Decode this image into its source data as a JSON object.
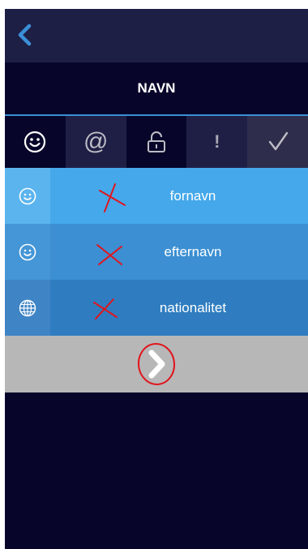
{
  "header": {
    "back_icon": "chevron-left-icon",
    "title": "NAVN"
  },
  "tabs": [
    {
      "icon": "smiley-icon",
      "active": true
    },
    {
      "icon": "at-sign-icon",
      "glyph": "@"
    },
    {
      "icon": "padlock-icon"
    },
    {
      "icon": "exclamation-icon",
      "glyph": "!"
    },
    {
      "icon": "checkmark-icon",
      "glyph": "✓"
    }
  ],
  "fields": [
    {
      "label": "fornavn",
      "icon": "smiley-icon",
      "annotation": "red-x"
    },
    {
      "label": "efternavn",
      "icon": "smiley-icon",
      "annotation": "red-x"
    },
    {
      "label": "nationalitet",
      "icon": "globe-icon",
      "annotation": "red-x"
    }
  ],
  "next": {
    "icon": "chevron-right-icon",
    "annotation": "red-circle"
  },
  "colors": {
    "background": "#07062a",
    "topbar": "#1e1f45",
    "accent_line": "#3b8fd6",
    "row1_lead": "#5bb4ee",
    "row1_main": "#45a8ea",
    "row2_lead": "#4596d6",
    "row2_main": "#3b8fd2",
    "row3_lead": "#3f85c6",
    "row3_main": "#2f7dc0",
    "next_bar": "#b7b7b7",
    "annotation": "#e0161e"
  }
}
